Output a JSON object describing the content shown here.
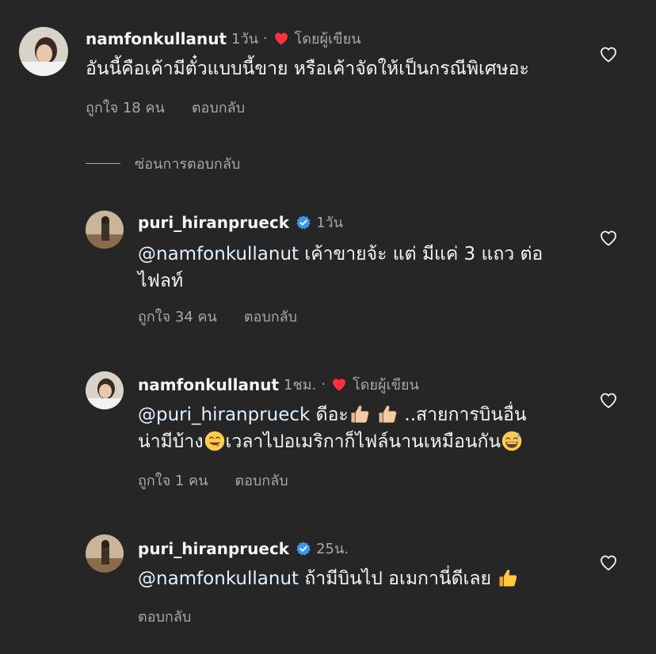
{
  "comments": [
    {
      "username": "namfonkullanut",
      "time": "1วัน",
      "dot": "·",
      "byauthor": "โดยผู้เขียน",
      "text": "อันนี้คือเค้ามีตั๋วแบบนี้ขาย หรือเค้าจัดให้เป็นกรณีพิเศษอะ",
      "likes": "ถูกใจ 18 คน",
      "reply": "ตอบกลับ"
    },
    {
      "username": "puri_hiranprueck",
      "time": "1วัน",
      "mention": "@namfonkullanut",
      "text_line1": " เค้าขายจ้ะ แต่ มีแค่ 3 แถว ต่อ",
      "text_line2": "ไฟลท์",
      "likes": "ถูกใจ 34 คน",
      "reply": "ตอบกลับ"
    },
    {
      "username": "namfonkullanut",
      "time": "1ชม.",
      "dot": "·",
      "byauthor": "โดยผู้เขียน",
      "mention": "@puri_hiranprueck",
      "text_a": " ดีอะ",
      "text_b": "..สายการบินอื่น",
      "text_c": "น่ามีบ้าง",
      "text_d": "เวลาไปอเมริกาก็ไฟล์นานเหมือนกัน",
      "likes": "ถูกใจ 1 คน",
      "reply": "ตอบกลับ"
    },
    {
      "username": "puri_hiranprueck",
      "time": "25น.",
      "mention": "@namfonkullanut",
      "text": " ถ้ามีบินไป อเมกานี่ดีเลย ",
      "reply": "ตอบกลับ"
    }
  ],
  "hide_replies": "ซ่อนการตอบกลับ",
  "icons": {
    "heart_outline": "heart-outline-icon",
    "heart_red": "heart-filled-icon",
    "verified": "verified-badge-icon",
    "thumbs_up": "thumbs-up-emoji",
    "yum": "face-savoring-food-emoji",
    "sweat_smile": "grinning-face-with-sweat-emoji"
  },
  "colors": {
    "background": "#262626",
    "text": "#f5f5f5",
    "secondary": "#a8a8a8",
    "heart": "#ff3040",
    "verified": "#0095f6"
  }
}
